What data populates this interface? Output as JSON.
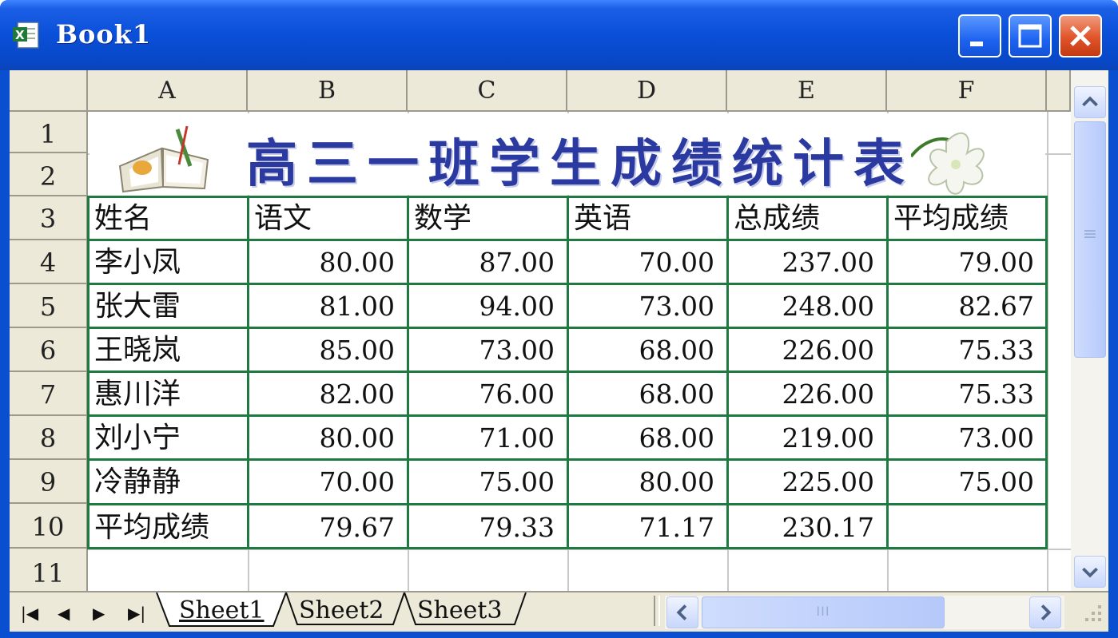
{
  "window": {
    "title": "Book1"
  },
  "columns": [
    "A",
    "B",
    "C",
    "D",
    "E",
    "F"
  ],
  "rows": [
    "1",
    "2",
    "3",
    "4",
    "5",
    "6",
    "7",
    "8",
    "9",
    "10",
    "11"
  ],
  "banner": {
    "title": "高三一班学生成绩统计表"
  },
  "table": {
    "headers": [
      "姓名",
      "语文",
      "数学",
      "英语",
      "总成绩",
      "平均成绩"
    ],
    "records": [
      [
        "李小凤",
        "80.00",
        "87.00",
        "70.00",
        "237.00",
        "79.00"
      ],
      [
        "张大雷",
        "81.00",
        "94.00",
        "73.00",
        "248.00",
        "82.67"
      ],
      [
        "王晓岚",
        "85.00",
        "73.00",
        "68.00",
        "226.00",
        "75.33"
      ],
      [
        "惠川洋",
        "82.00",
        "76.00",
        "68.00",
        "226.00",
        "75.33"
      ],
      [
        "刘小宁",
        "80.00",
        "71.00",
        "68.00",
        "219.00",
        "73.00"
      ],
      [
        "冷静静",
        "70.00",
        "75.00",
        "80.00",
        "225.00",
        "75.00"
      ],
      [
        "平均成绩",
        "79.67",
        "79.33",
        "71.17",
        "230.17",
        ""
      ]
    ]
  },
  "sheets": [
    "Sheet1",
    "Sheet2",
    "Sheet3"
  ],
  "scrollbar": {
    "h_thumb_grip": "III",
    "v_thumb_grip": "≡"
  },
  "colors": {
    "titlebar": "#0a4fd8",
    "table_border": "#1e7a3e",
    "banner_text": "#2a3aa0"
  }
}
